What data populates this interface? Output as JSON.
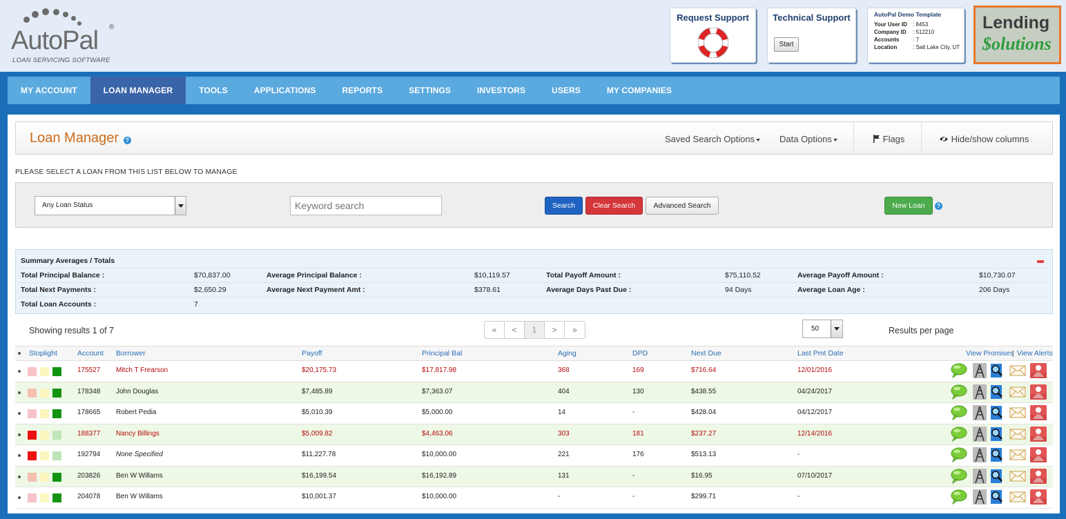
{
  "header": {
    "logo": {
      "name": "AutoPal",
      "registered": "®",
      "subtitle": "LOAN SERVICING SOFTWARE"
    },
    "request_support": {
      "title": "Request Support",
      "icon": "lifebuoy-icon"
    },
    "technical_support": {
      "title": "Technical Support",
      "start_label": "Start"
    },
    "account_info": {
      "title": "AutoPal Demo Template",
      "rows": [
        {
          "label": "Your User ID",
          "value": ": 8453"
        },
        {
          "label": "Company ID",
          "value": ": 512210"
        },
        {
          "label": "Accounts",
          "value": ": 7"
        },
        {
          "label": "Location",
          "value": ": Salt Lake City, UT"
        }
      ]
    },
    "partner_logo": {
      "line1": "Lending",
      "line2": "$olutions"
    }
  },
  "nav": {
    "items": [
      "MY ACCOUNT",
      "LOAN MANAGER",
      "TOOLS",
      "APPLICATIONS",
      "REPORTS",
      "SETTINGS",
      "INVESTORS",
      "USERS",
      "MY COMPANIES"
    ],
    "active": "LOAN MANAGER"
  },
  "page": {
    "title": "Loan Manager",
    "help": "?",
    "options": {
      "saved_search": "Saved Search Options",
      "data_options": "Data Options",
      "flags": "Flags",
      "hide_show": "Hide/show columns"
    },
    "prompt": "PLEASE SELECT A LOAN FROM THIS LIST BELOW TO MANAGE"
  },
  "search": {
    "status_value": "Any Loan Status",
    "keyword_placeholder": "Keyword search",
    "search_label": "Search",
    "clear_label": "Clear Search",
    "advanced_label": "Advanced Search",
    "new_loan_label": "New Loan"
  },
  "summary": {
    "title": "Summary Averages / Totals",
    "items": {
      "total_principal_balance": {
        "label": "Total Principal Balance :",
        "value": "$70,837.00"
      },
      "average_principal_balance": {
        "label": "Average Principal Balance :",
        "value": "$10,119.57"
      },
      "total_payoff_amount": {
        "label": "Total Payoff Amount :",
        "value": "$75,110.52"
      },
      "average_payoff_amount": {
        "label": "Average Payoff Amount :",
        "value": "$10,730.07"
      },
      "total_next_payments": {
        "label": "Total Next Payments :",
        "value": "$2,650.29"
      },
      "average_next_payment_amt": {
        "label": "Average Next Payment Amt :",
        "value": "$378.61"
      },
      "average_days_past_due": {
        "label": "Average Days Past Due :",
        "value": "94 Days"
      },
      "average_loan_age": {
        "label": "Average Loan Age :",
        "value": "206 Days"
      },
      "total_loan_accounts": {
        "label": "Total Loan Accounts :",
        "value": "7"
      }
    }
  },
  "results": {
    "showing": "Showing results 1 of 7",
    "pager": [
      "«",
      "<",
      "1",
      ">",
      "»"
    ],
    "per_page_value": "50",
    "per_page_label": "Results per page"
  },
  "grid": {
    "headers": {
      "stoplight": "Stoplight",
      "account": "Account",
      "borrower": "Borrower",
      "payoff": "Payoff",
      "principal_bal": "Principal Bal",
      "aging": "Aging",
      "dpd": "DPD",
      "next_due": "Next Due",
      "last_pmt_date": "Last Pmt Date",
      "view_promises": "View Promises",
      "divider": "|",
      "view_alerts": "View Alerts"
    },
    "rows": [
      {
        "account": "175527",
        "borrower": "Mitch T Frearson",
        "payoff": "$20,175.73",
        "principal": "$17,817.98",
        "aging": "368",
        "dpd": "169",
        "next_due": "$716.64",
        "last_pmt": "12/01/2016",
        "delinquent": true,
        "stoplight": [
          "#f6c3c8",
          "#fbf6bd",
          "#129312"
        ]
      },
      {
        "account": "178348",
        "borrower": "John Douglas",
        "payoff": "$7,485.89",
        "principal": "$7,363.07",
        "aging": "404",
        "dpd": "130",
        "next_due": "$438.55",
        "last_pmt": "04/24/2017",
        "delinquent": false,
        "stoplight": [
          "#f5c0b0",
          "#fbf6bd",
          "#129312"
        ]
      },
      {
        "account": "178665",
        "borrower": "Robert Pedia",
        "payoff": "$5,010.39",
        "principal": "$5,000.00",
        "aging": "14",
        "dpd": "-",
        "next_due": "$428.04",
        "last_pmt": "04/12/2017",
        "delinquent": false,
        "stoplight": [
          "#f6c3c8",
          "#fbf6bd",
          "#129312"
        ]
      },
      {
        "account": "188377",
        "borrower": "Nancy Billings",
        "payoff": "$5,009.82",
        "principal": "$4,463.06",
        "aging": "303",
        "dpd": "181",
        "next_due": "$237.27",
        "last_pmt": "12/14/2016",
        "delinquent": true,
        "stoplight": [
          "#ee1111",
          "#fbf6bd",
          "#bfe4b8"
        ]
      },
      {
        "account": "192794",
        "borrower": "None Specified",
        "payoff": "$11,227.78",
        "principal": "$10,000.00",
        "aging": "221",
        "dpd": "176",
        "next_due": "$513.13",
        "last_pmt": "-",
        "delinquent": false,
        "italic": true,
        "stoplight": [
          "#ee1111",
          "#fbf6bd",
          "#bfe4b8"
        ]
      },
      {
        "account": "203826",
        "borrower": "Ben W Willams",
        "payoff": "$16,199.54",
        "principal": "$16,192.89",
        "aging": "131",
        "dpd": "-",
        "next_due": "$16.95",
        "last_pmt": "07/10/2017",
        "delinquent": false,
        "stoplight": [
          "#f5c0b0",
          "#fbf6bd",
          "#129312"
        ]
      },
      {
        "account": "204078",
        "borrower": "Ben W Willams",
        "payoff": "$10,001.37",
        "principal": "$10,000.00",
        "aging": "-",
        "dpd": "-",
        "next_due": "$299.71",
        "last_pmt": "-",
        "delinquent": false,
        "stoplight": [
          "#f6c3c8",
          "#fbf6bd",
          "#129312"
        ]
      }
    ],
    "row_actions": [
      "chat-bubble-icon",
      "tower-icon",
      "search-doc-icon",
      "envelope-icon",
      "person-icon"
    ]
  },
  "colors": {
    "nav_bg": "#5aa9df",
    "nav_active": "#3a64a8",
    "title_orange": "#cc6a18",
    "link_blue": "#2a6db5",
    "delinquent_red": "#b50a0a"
  }
}
